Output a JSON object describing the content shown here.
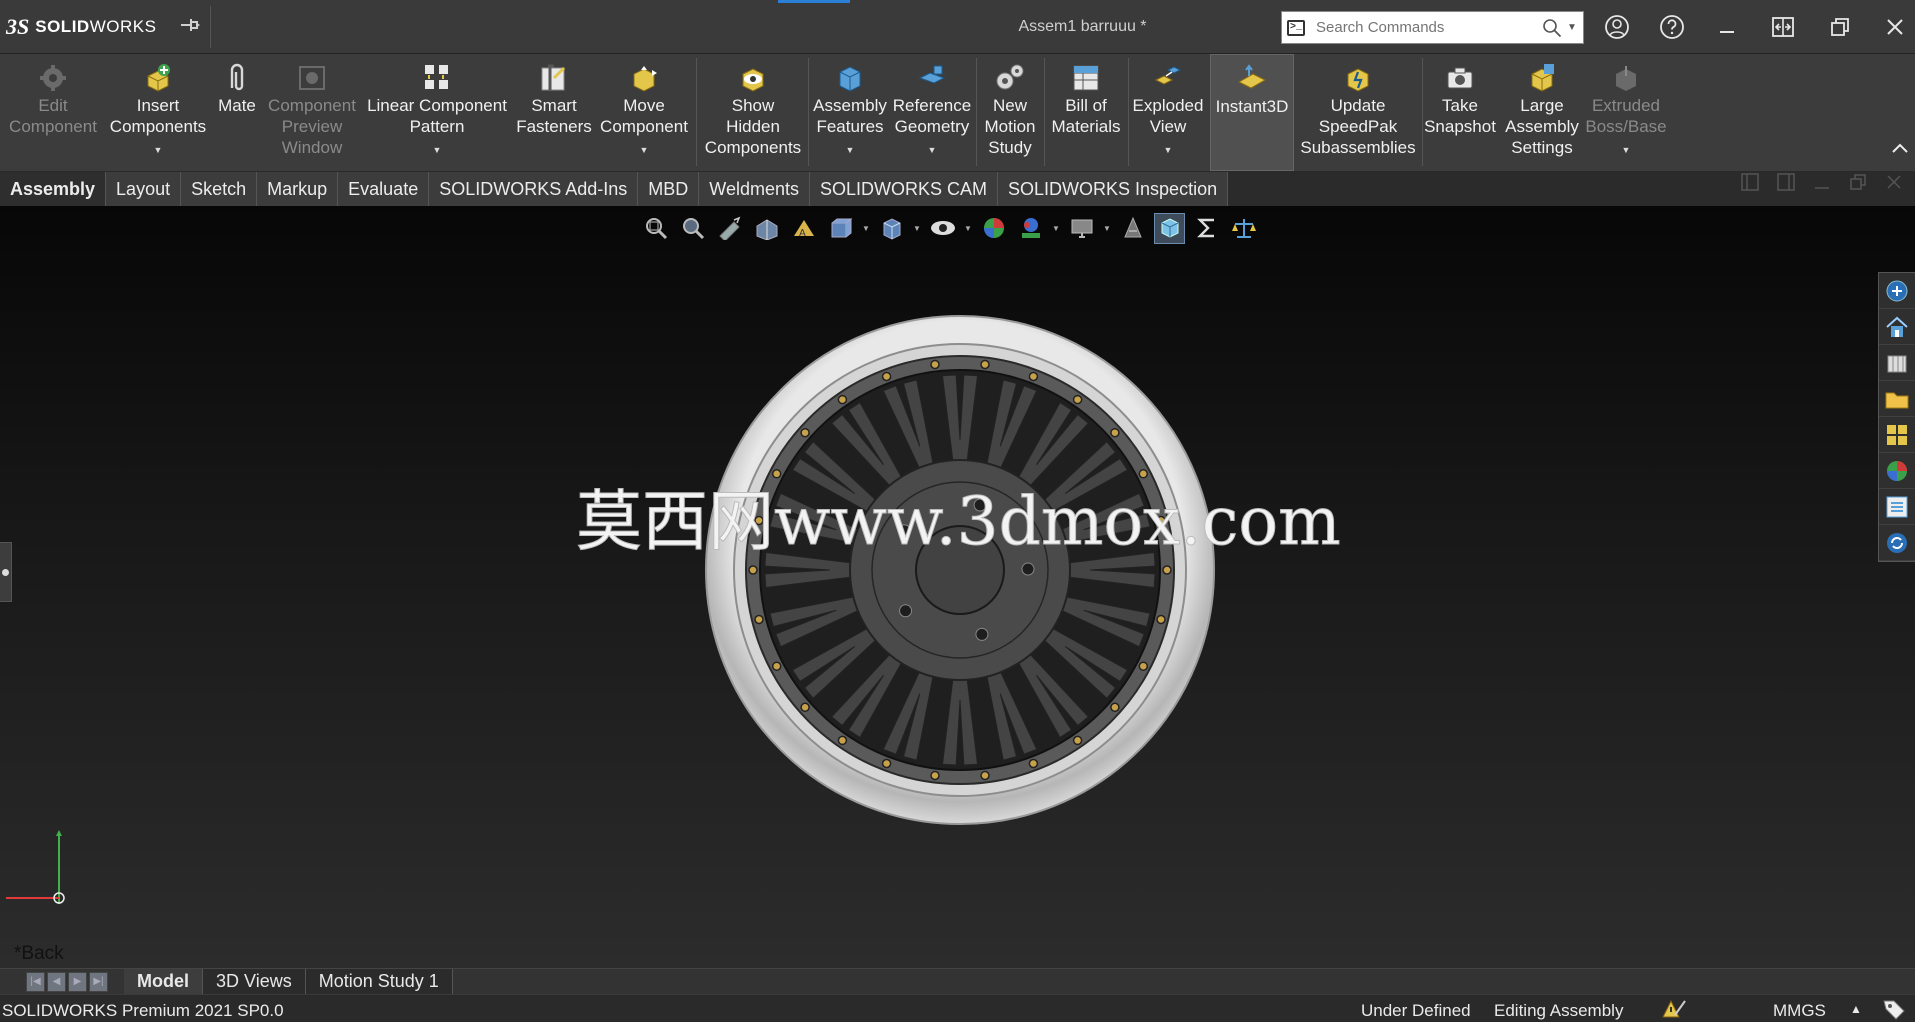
{
  "app": {
    "brand_ds": "3S",
    "brand_name_bold": "SOLID",
    "brand_name_thin": "WORKS",
    "document_title": "Assem1 barruuu *"
  },
  "search": {
    "placeholder": "Search Commands",
    "value": ""
  },
  "commands": [
    {
      "id": "edit-component",
      "label_lines": [
        "Edit",
        "Component"
      ],
      "enabled": false,
      "dropdown": false
    },
    {
      "id": "insert-components",
      "label_lines": [
        "Insert",
        "Components"
      ],
      "enabled": true,
      "dropdown": true
    },
    {
      "id": "mate",
      "label_lines": [
        "Mate"
      ],
      "enabled": true,
      "dropdown": false
    },
    {
      "id": "component-preview-window",
      "label_lines": [
        "Component",
        "Preview",
        "Window"
      ],
      "enabled": false,
      "dropdown": false
    },
    {
      "id": "linear-component-pattern",
      "label_lines": [
        "Linear Component",
        "Pattern"
      ],
      "enabled": true,
      "dropdown": true
    },
    {
      "id": "smart-fasteners",
      "label_lines": [
        "Smart",
        "Fasteners"
      ],
      "enabled": true,
      "dropdown": false
    },
    {
      "id": "move-component",
      "label_lines": [
        "Move",
        "Component"
      ],
      "enabled": true,
      "dropdown": true
    },
    {
      "id": "show-hidden-components",
      "label_lines": [
        "Show",
        "Hidden",
        "Components"
      ],
      "enabled": true,
      "dropdown": false
    },
    {
      "id": "assembly-features",
      "label_lines": [
        "Assembly",
        "Features"
      ],
      "enabled": true,
      "dropdown": true
    },
    {
      "id": "reference-geometry",
      "label_lines": [
        "Reference",
        "Geometry"
      ],
      "enabled": true,
      "dropdown": true
    },
    {
      "id": "new-motion-study",
      "label_lines": [
        "New",
        "Motion",
        "Study"
      ],
      "enabled": true,
      "dropdown": false
    },
    {
      "id": "bill-of-materials",
      "label_lines": [
        "Bill of",
        "Materials"
      ],
      "enabled": true,
      "dropdown": false
    },
    {
      "id": "exploded-view",
      "label_lines": [
        "Exploded",
        "View"
      ],
      "enabled": true,
      "dropdown": true
    },
    {
      "id": "instant3d",
      "label_lines": [
        "Instant3D"
      ],
      "enabled": true,
      "dropdown": false
    },
    {
      "id": "update-speedpak",
      "label_lines": [
        "Update",
        "SpeedPak",
        "Subassemblies"
      ],
      "enabled": true,
      "dropdown": false
    },
    {
      "id": "take-snapshot",
      "label_lines": [
        "Take",
        "Snapshot"
      ],
      "enabled": true,
      "dropdown": false
    },
    {
      "id": "large-assembly-settings",
      "label_lines": [
        "Large",
        "Assembly",
        "Settings"
      ],
      "enabled": true,
      "dropdown": false
    },
    {
      "id": "extruded-boss-base",
      "label_lines": [
        "Extruded",
        "Boss/Base"
      ],
      "enabled": false,
      "dropdown": true
    }
  ],
  "tabs": [
    {
      "label": "Assembly",
      "active": true
    },
    {
      "label": "Layout",
      "active": false
    },
    {
      "label": "Sketch",
      "active": false
    },
    {
      "label": "Markup",
      "active": false
    },
    {
      "label": "Evaluate",
      "active": false
    },
    {
      "label": "SOLIDWORKS Add-Ins",
      "active": false
    },
    {
      "label": "MBD",
      "active": false
    },
    {
      "label": "Weldments",
      "active": false
    },
    {
      "label": "SOLIDWORKS CAM",
      "active": false
    },
    {
      "label": "SOLIDWORKS Inspection",
      "active": false
    }
  ],
  "viewport": {
    "watermark": "莫西网www.3dmox.com",
    "back_label": "*Back"
  },
  "bottom_tabs": [
    {
      "label": "Model",
      "active": true
    },
    {
      "label": "3D Views",
      "active": false
    },
    {
      "label": "Motion Study 1",
      "active": false
    }
  ],
  "status": {
    "product": "SOLIDWORKS Premium 2021 SP0.0",
    "definition": "Under Defined",
    "mode": "Editing Assembly",
    "units": "MMGS"
  },
  "colors": {
    "accent": "#2a7fd6",
    "wheel_rim": "#c9c9c9",
    "wheel_face": "#444444",
    "bolts": "#c8a24a"
  }
}
